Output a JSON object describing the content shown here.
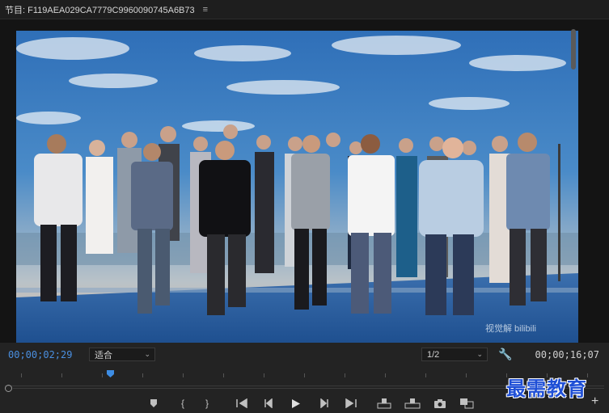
{
  "panel": {
    "title": "节目: F119AEA029CA7779C9960090745A6B73",
    "menu_glyph": "≡"
  },
  "video": {
    "watermark": "视觉解 bilibili"
  },
  "controls": {
    "current_timecode": "00;00;02;29",
    "fit_select": "适合",
    "resolution_select": "1/2",
    "duration_timecode": "00;00;16;07",
    "settings_icon": "wrench-icon"
  },
  "transport": [
    {
      "name": "add-marker-button",
      "icon": "marker-icon"
    },
    {
      "name": "mark-in-button",
      "icon": "mark-in-icon"
    },
    {
      "name": "mark-out-button",
      "icon": "mark-out-icon"
    },
    {
      "name": "go-to-in-button",
      "icon": "go-to-in-icon"
    },
    {
      "name": "step-back-button",
      "icon": "step-back-icon"
    },
    {
      "name": "play-button",
      "icon": "play-icon"
    },
    {
      "name": "step-forward-button",
      "icon": "step-forward-icon"
    },
    {
      "name": "go-to-out-button",
      "icon": "go-to-out-icon"
    },
    {
      "name": "lift-button",
      "icon": "lift-icon"
    },
    {
      "name": "extract-button",
      "icon": "extract-icon"
    },
    {
      "name": "export-frame-button",
      "icon": "camera-icon"
    },
    {
      "name": "comparison-view-button",
      "icon": "comparison-icon"
    }
  ],
  "site_watermark": "最需教育"
}
